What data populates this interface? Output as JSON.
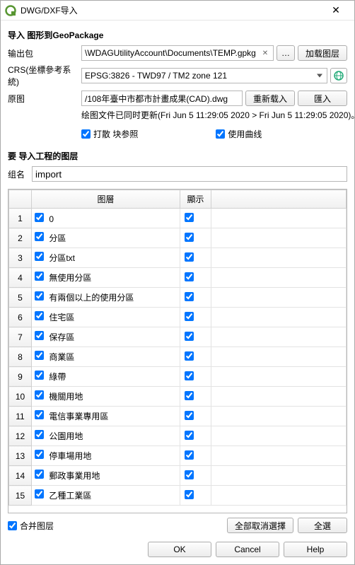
{
  "window": {
    "title": "DWG/DXF导入"
  },
  "import_section": {
    "heading": "导入 图形到GeoPackage",
    "output_pkg_label": "输出包",
    "output_pkg_value": "\\WDAGUtilityAccount\\Documents\\TEMP.gpkg",
    "browse_btn": "…",
    "load_layers_btn": "加载图层",
    "crs_label": "CRS(坐標參考系統)",
    "crs_value": "EPSG:3826 - TWD97 / TM2 zone 121",
    "source_label": "原图",
    "source_value": "/108年臺中市都市計畫成果(CAD).dwg",
    "reload_btn": "重新载入",
    "import_btn": "匯入",
    "status_text": "绘图文件已同时更新(Fri Jun 5 11:29:05 2020 > Fri Jun 5 11:29:05 2020)。",
    "scatter_cb": "打散 块参照",
    "curves_cb": "使用曲线"
  },
  "layers_section": {
    "heading": "要 导入工程的图层",
    "group_label": "组名",
    "group_value": "import",
    "col_layer": "图層",
    "col_visible": "顯示",
    "rows": [
      {
        "n": "1",
        "name": "0"
      },
      {
        "n": "2",
        "name": "分區"
      },
      {
        "n": "3",
        "name": "分區txt"
      },
      {
        "n": "4",
        "name": "無使用分區"
      },
      {
        "n": "5",
        "name": "有兩個以上的使用分區"
      },
      {
        "n": "6",
        "name": "住宅區"
      },
      {
        "n": "7",
        "name": "保存區"
      },
      {
        "n": "8",
        "name": "商業區"
      },
      {
        "n": "9",
        "name": "綠帶"
      },
      {
        "n": "10",
        "name": "機關用地"
      },
      {
        "n": "11",
        "name": "電信事業專用區"
      },
      {
        "n": "12",
        "name": "公園用地"
      },
      {
        "n": "13",
        "name": "停車場用地"
      },
      {
        "n": "14",
        "name": "郵政事業用地"
      },
      {
        "n": "15",
        "name": "乙種工業區"
      }
    ],
    "merge_cb": "合并图层",
    "deselect_all_btn": "全部取消選擇",
    "select_all_btn": "全選"
  },
  "dialog": {
    "ok": "OK",
    "cancel": "Cancel",
    "help": "Help"
  }
}
